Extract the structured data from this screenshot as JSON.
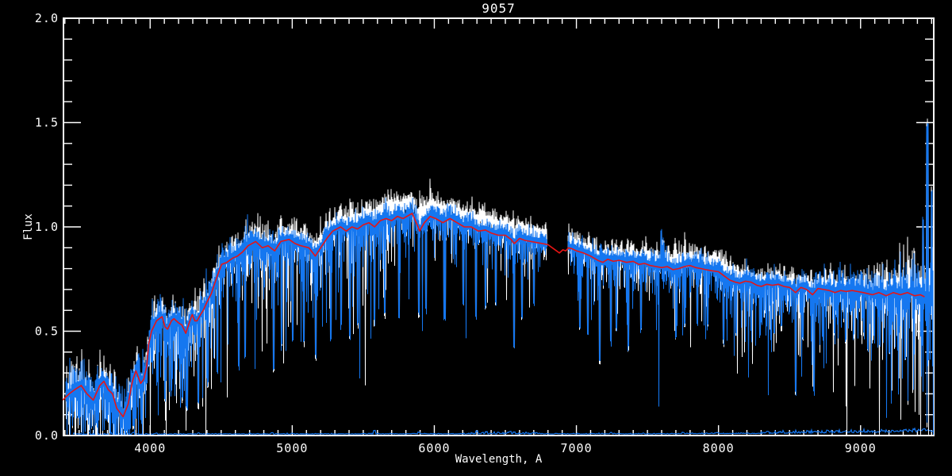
{
  "window": {
    "title": "9057"
  },
  "colors": {
    "background": "#000000",
    "axis": "#ffffff",
    "spectrum_blue": "#1577f0",
    "spectrum_white": "#ffffff",
    "model_red": "#e81414"
  },
  "chart_data": {
    "type": "line",
    "title": "9057",
    "xlabel": "Wavelength, A",
    "ylabel": "Flux",
    "xlim": [
      3390,
      9515
    ],
    "ylim": [
      0,
      2
    ],
    "grid": false,
    "legend": "none",
    "xticks": [
      4000,
      5000,
      6000,
      7000,
      8000,
      9000
    ],
    "xtick_labels": [
      "4000",
      "5000",
      "6000",
      "7000",
      "8000",
      "9000"
    ],
    "x_minor_step": 100,
    "yticks": [
      0,
      0.5,
      1.0,
      1.5,
      2.0
    ],
    "ytick_labels": [
      "0.0",
      "0.5",
      "1.0",
      "1.5",
      "2.0"
    ],
    "y_minor_step": 0.1,
    "series": [
      {
        "name": "raw spectrum",
        "color": "#ffffff",
        "style": "noisy"
      },
      {
        "name": "observed spectrum",
        "color": "#1577f0",
        "style": "noisy"
      },
      {
        "name": "template fit",
        "color": "#e81414",
        "style": "smooth"
      },
      {
        "name": "error spectrum",
        "color": "#1577f0",
        "style": "noisy-low"
      }
    ],
    "data_gap": [
      6792,
      6938
    ],
    "noise_seed": 90573,
    "model_points": [
      [
        3385,
        0.17
      ],
      [
        3430,
        0.2
      ],
      [
        3470,
        0.22
      ],
      [
        3515,
        0.24
      ],
      [
        3555,
        0.2
      ],
      [
        3600,
        0.17
      ],
      [
        3645,
        0.24
      ],
      [
        3675,
        0.26
      ],
      [
        3705,
        0.22
      ],
      [
        3735,
        0.2
      ],
      [
        3765,
        0.13
      ],
      [
        3810,
        0.09
      ],
      [
        3845,
        0.15
      ],
      [
        3875,
        0.26
      ],
      [
        3900,
        0.31
      ],
      [
        3933,
        0.25
      ],
      [
        3955,
        0.27
      ],
      [
        3975,
        0.33
      ],
      [
        3990,
        0.44
      ],
      [
        4010,
        0.5
      ],
      [
        4045,
        0.55
      ],
      [
        4084,
        0.57
      ],
      [
        4105,
        0.52
      ],
      [
        4123,
        0.51
      ],
      [
        4150,
        0.55
      ],
      [
        4168,
        0.56
      ],
      [
        4200,
        0.54
      ],
      [
        4223,
        0.53
      ],
      [
        4251,
        0.49
      ],
      [
        4275,
        0.54
      ],
      [
        4296,
        0.58
      ],
      [
        4315,
        0.55
      ],
      [
        4330,
        0.55
      ],
      [
        4355,
        0.58
      ],
      [
        4374,
        0.6
      ],
      [
        4400,
        0.64
      ],
      [
        4430,
        0.68
      ],
      [
        4470,
        0.76
      ],
      [
        4503,
        0.82
      ],
      [
        4540,
        0.83
      ],
      [
        4580,
        0.85
      ],
      [
        4615,
        0.86
      ],
      [
        4650,
        0.88
      ],
      [
        4690,
        0.91
      ],
      [
        4743,
        0.93
      ],
      [
        4790,
        0.9
      ],
      [
        4830,
        0.91
      ],
      [
        4877,
        0.885
      ],
      [
        4920,
        0.93
      ],
      [
        4978,
        0.94
      ],
      [
        5020,
        0.92
      ],
      [
        5060,
        0.91
      ],
      [
        5117,
        0.9
      ],
      [
        5162,
        0.86
      ],
      [
        5200,
        0.9
      ],
      [
        5250,
        0.95
      ],
      [
        5285,
        0.98
      ],
      [
        5341,
        1.0
      ],
      [
        5380,
        0.98
      ],
      [
        5420,
        1.0
      ],
      [
        5460,
        0.99
      ],
      [
        5500,
        1.01
      ],
      [
        5540,
        1.02
      ],
      [
        5580,
        1.0
      ],
      [
        5620,
        1.03
      ],
      [
        5660,
        1.04
      ],
      [
        5700,
        1.03
      ],
      [
        5740,
        1.05
      ],
      [
        5780,
        1.04
      ],
      [
        5844,
        1.065
      ],
      [
        5886,
        1.0
      ],
      [
        5896,
        0.98
      ],
      [
        5930,
        1.02
      ],
      [
        5970,
        1.05
      ],
      [
        6010,
        1.04
      ],
      [
        6060,
        1.02
      ],
      [
        6110,
        1.04
      ],
      [
        6160,
        1.02
      ],
      [
        6210,
        1.0
      ],
      [
        6260,
        1.0
      ],
      [
        6310,
        0.98
      ],
      [
        6360,
        0.985
      ],
      [
        6402,
        0.97
      ],
      [
        6450,
        0.96
      ],
      [
        6500,
        0.96
      ],
      [
        6540,
        0.94
      ],
      [
        6563,
        0.92
      ],
      [
        6600,
        0.945
      ],
      [
        6640,
        0.935
      ],
      [
        6680,
        0.93
      ],
      [
        6720,
        0.925
      ],
      [
        6760,
        0.92
      ],
      [
        6800,
        0.915
      ],
      [
        6830,
        0.9
      ],
      [
        6860,
        0.885
      ],
      [
        6880,
        0.875
      ],
      [
        6905,
        0.89
      ],
      [
        6925,
        0.885
      ],
      [
        6945,
        0.9
      ],
      [
        6970,
        0.895
      ],
      [
        7000,
        0.885
      ],
      [
        7050,
        0.875
      ],
      [
        7100,
        0.86
      ],
      [
        7150,
        0.84
      ],
      [
        7186,
        0.83
      ],
      [
        7220,
        0.845
      ],
      [
        7260,
        0.835
      ],
      [
        7300,
        0.84
      ],
      [
        7352,
        0.83
      ],
      [
        7400,
        0.835
      ],
      [
        7440,
        0.82
      ],
      [
        7480,
        0.825
      ],
      [
        7520,
        0.815
      ],
      [
        7560,
        0.81
      ],
      [
        7600,
        0.805
      ],
      [
        7640,
        0.81
      ],
      [
        7680,
        0.795
      ],
      [
        7720,
        0.8
      ],
      [
        7760,
        0.81
      ],
      [
        7800,
        0.815
      ],
      [
        7840,
        0.805
      ],
      [
        7880,
        0.8
      ],
      [
        7911,
        0.795
      ],
      [
        7950,
        0.79
      ],
      [
        8000,
        0.785
      ],
      [
        8040,
        0.765
      ],
      [
        8080,
        0.745
      ],
      [
        8120,
        0.735
      ],
      [
        8151,
        0.73
      ],
      [
        8190,
        0.74
      ],
      [
        8230,
        0.735
      ],
      [
        8270,
        0.72
      ],
      [
        8302,
        0.715
      ],
      [
        8340,
        0.725
      ],
      [
        8380,
        0.72
      ],
      [
        8420,
        0.725
      ],
      [
        8460,
        0.715
      ],
      [
        8500,
        0.71
      ],
      [
        8543,
        0.685
      ],
      [
        8580,
        0.71
      ],
      [
        8620,
        0.7
      ],
      [
        8662,
        0.675
      ],
      [
        8700,
        0.705
      ],
      [
        8740,
        0.7
      ],
      [
        8780,
        0.695
      ],
      [
        8820,
        0.685
      ],
      [
        8860,
        0.695
      ],
      [
        8900,
        0.69
      ],
      [
        8940,
        0.695
      ],
      [
        8980,
        0.69
      ],
      [
        9020,
        0.685
      ],
      [
        9084,
        0.675
      ],
      [
        9130,
        0.685
      ],
      [
        9180,
        0.67
      ],
      [
        9230,
        0.685
      ],
      [
        9280,
        0.675
      ],
      [
        9330,
        0.685
      ],
      [
        9380,
        0.67
      ],
      [
        9420,
        0.675
      ],
      [
        9450,
        0.665
      ]
    ],
    "deep_absorptions": [
      [
        3500,
        0.06
      ],
      [
        3560,
        0.05
      ],
      [
        3620,
        0.04
      ],
      [
        3700,
        0.06
      ],
      [
        3750,
        0.03
      ],
      [
        3800,
        0.02
      ],
      [
        3880,
        0.02
      ],
      [
        3934,
        0.05
      ],
      [
        4046,
        0.22
      ],
      [
        4102,
        0.15
      ],
      [
        4144,
        0.18
      ],
      [
        4227,
        0.15
      ],
      [
        4260,
        0.1
      ],
      [
        4335,
        0.12
      ],
      [
        4405,
        0.22
      ],
      [
        4470,
        0.28
      ],
      [
        4620,
        0.3
      ],
      [
        4668,
        0.35
      ],
      [
        4866,
        0.3
      ],
      [
        4920,
        0.4
      ],
      [
        5000,
        0.45
      ],
      [
        5080,
        0.42
      ],
      [
        5165,
        0.35
      ],
      [
        5270,
        0.45
      ],
      [
        5340,
        0.5
      ],
      [
        5405,
        0.45
      ],
      [
        5460,
        0.5
      ],
      [
        5577,
        0.52
      ],
      [
        5650,
        0.55
      ],
      [
        5750,
        0.55
      ],
      [
        5886,
        0.55
      ],
      [
        5940,
        0.58
      ],
      [
        6070,
        0.55
      ],
      [
        6200,
        0.6
      ],
      [
        6290,
        0.55
      ],
      [
        6360,
        0.6
      ],
      [
        6432,
        0.62
      ],
      [
        6559,
        0.39
      ],
      [
        6614,
        0.55
      ],
      [
        6700,
        0.6
      ],
      [
        7020,
        0.5
      ],
      [
        7080,
        0.48
      ],
      [
        7160,
        0.33
      ],
      [
        7240,
        0.42
      ],
      [
        7280,
        0.5
      ],
      [
        7360,
        0.4
      ],
      [
        7450,
        0.48
      ],
      [
        7700,
        0.45
      ],
      [
        7760,
        0.5
      ],
      [
        7850,
        0.52
      ],
      [
        7920,
        0.5
      ],
      [
        8030,
        0.42
      ],
      [
        8120,
        0.46
      ],
      [
        8230,
        0.5
      ],
      [
        8290,
        0.45
      ],
      [
        8390,
        0.48
      ],
      [
        8440,
        0.5
      ],
      [
        8543,
        0.19
      ],
      [
        8590,
        0.45
      ],
      [
        8671,
        0.19
      ],
      [
        8730,
        0.45
      ],
      [
        8815,
        0.47
      ],
      [
        8890,
        0.42
      ],
      [
        8950,
        0.45
      ],
      [
        9050,
        0.4
      ],
      [
        9130,
        0.42
      ],
      [
        9200,
        0.38
      ],
      [
        9260,
        0.4
      ],
      [
        9310,
        0.33
      ],
      [
        9370,
        0.38
      ],
      [
        9430,
        0.42
      ]
    ],
    "emission_spikes": [
      [
        7597,
        1.0
      ],
      [
        7612,
        0.96
      ],
      [
        9440,
        1.05
      ],
      [
        9470,
        1.52
      ],
      [
        9500,
        1.2
      ]
    ],
    "sigma_down_points": [
      [
        3390,
        0.1
      ],
      [
        3700,
        0.11
      ],
      [
        3900,
        0.1
      ],
      [
        4050,
        0.1
      ],
      [
        4300,
        0.09
      ],
      [
        4600,
        0.08
      ],
      [
        4900,
        0.07
      ],
      [
        5200,
        0.065
      ],
      [
        5600,
        0.055
      ],
      [
        6000,
        0.05
      ],
      [
        6400,
        0.045
      ],
      [
        6800,
        0.045
      ],
      [
        7000,
        0.05
      ],
      [
        7400,
        0.05
      ],
      [
        7800,
        0.05
      ],
      [
        8200,
        0.055
      ],
      [
        8600,
        0.06
      ],
      [
        9000,
        0.07
      ],
      [
        9250,
        0.09
      ],
      [
        9515,
        0.13
      ]
    ],
    "sigma_up_points": [
      [
        3390,
        0.06
      ],
      [
        4000,
        0.05
      ],
      [
        4500,
        0.04
      ],
      [
        5000,
        0.035
      ],
      [
        5500,
        0.03
      ],
      [
        6000,
        0.03
      ],
      [
        6500,
        0.025
      ],
      [
        7000,
        0.025
      ],
      [
        7600,
        0.03
      ],
      [
        8200,
        0.03
      ],
      [
        8800,
        0.035
      ],
      [
        9200,
        0.06
      ],
      [
        9515,
        0.1
      ]
    ],
    "spike_prob_points": [
      [
        3390,
        0.55
      ],
      [
        4000,
        0.5
      ],
      [
        4400,
        0.45
      ],
      [
        4800,
        0.4
      ],
      [
        5200,
        0.38
      ],
      [
        5600,
        0.33
      ],
      [
        6000,
        0.3
      ],
      [
        6500,
        0.28
      ],
      [
        7000,
        0.33
      ],
      [
        7500,
        0.35
      ],
      [
        8000,
        0.38
      ],
      [
        8500,
        0.42
      ],
      [
        9000,
        0.46
      ],
      [
        9515,
        0.55
      ]
    ],
    "spike_scale_points": [
      [
        3390,
        0.1
      ],
      [
        3800,
        0.12
      ],
      [
        4200,
        0.16
      ],
      [
        4600,
        0.18
      ],
      [
        5000,
        0.18
      ],
      [
        5400,
        0.16
      ],
      [
        5800,
        0.15
      ],
      [
        6200,
        0.13
      ],
      [
        6600,
        0.12
      ],
      [
        7000,
        0.11
      ],
      [
        7400,
        0.11
      ],
      [
        7800,
        0.11
      ],
      [
        8200,
        0.12
      ],
      [
        8600,
        0.13
      ],
      [
        9000,
        0.13
      ],
      [
        9300,
        0.16
      ],
      [
        9515,
        0.2
      ]
    ],
    "white_offset_points": [
      [
        3390,
        0.005
      ],
      [
        4500,
        0.01
      ],
      [
        5000,
        0.02
      ],
      [
        5300,
        0.03
      ],
      [
        5600,
        0.05
      ],
      [
        5900,
        0.055
      ],
      [
        6200,
        0.05
      ],
      [
        6500,
        0.05
      ],
      [
        6800,
        0.04
      ],
      [
        7100,
        0.02
      ],
      [
        7400,
        0.025
      ],
      [
        7700,
        0.035
      ],
      [
        8000,
        0.04
      ],
      [
        8300,
        0.02
      ],
      [
        8700,
        0.02
      ],
      [
        9000,
        0.02
      ],
      [
        9300,
        0.03
      ],
      [
        9515,
        0.03
      ]
    ],
    "error_base_points": [
      [
        3400,
        0.005
      ],
      [
        4500,
        0.006
      ],
      [
        6000,
        0.007
      ],
      [
        7500,
        0.007
      ],
      [
        8300,
        0.009
      ],
      [
        8800,
        0.012
      ],
      [
        9200,
        0.015
      ],
      [
        9515,
        0.018
      ]
    ],
    "error_bumps": [
      [
        3570,
        0.012
      ],
      [
        3720,
        0.012
      ],
      [
        3800,
        0.014
      ],
      [
        3880,
        0.012
      ],
      [
        4046,
        0.01
      ],
      [
        4340,
        0.01
      ],
      [
        4861,
        0.01
      ],
      [
        5000,
        0.009
      ],
      [
        5577,
        0.022
      ],
      [
        5890,
        0.014
      ],
      [
        6300,
        0.02
      ],
      [
        6364,
        0.016
      ],
      [
        6450,
        0.014
      ],
      [
        6533,
        0.018
      ],
      [
        6562,
        0.014
      ],
      [
        6700,
        0.012
      ],
      [
        7245,
        0.012
      ],
      [
        7750,
        0.012
      ],
      [
        7993,
        0.011
      ],
      [
        8345,
        0.018
      ],
      [
        8430,
        0.016
      ],
      [
        8505,
        0.014
      ],
      [
        8630,
        0.02
      ],
      [
        8700,
        0.016
      ],
      [
        8767,
        0.022
      ],
      [
        8827,
        0.02
      ],
      [
        8885,
        0.018
      ],
      [
        8920,
        0.016
      ],
      [
        9001,
        0.014
      ],
      [
        9065,
        0.016
      ],
      [
        9150,
        0.02
      ],
      [
        9225,
        0.022
      ],
      [
        9260,
        0.018
      ],
      [
        9310,
        0.025
      ],
      [
        9350,
        0.02
      ],
      [
        9376,
        0.028
      ],
      [
        9420,
        0.022
      ],
      [
        9440,
        0.03
      ],
      [
        9470,
        0.024
      ],
      [
        9490,
        0.02
      ]
    ]
  }
}
